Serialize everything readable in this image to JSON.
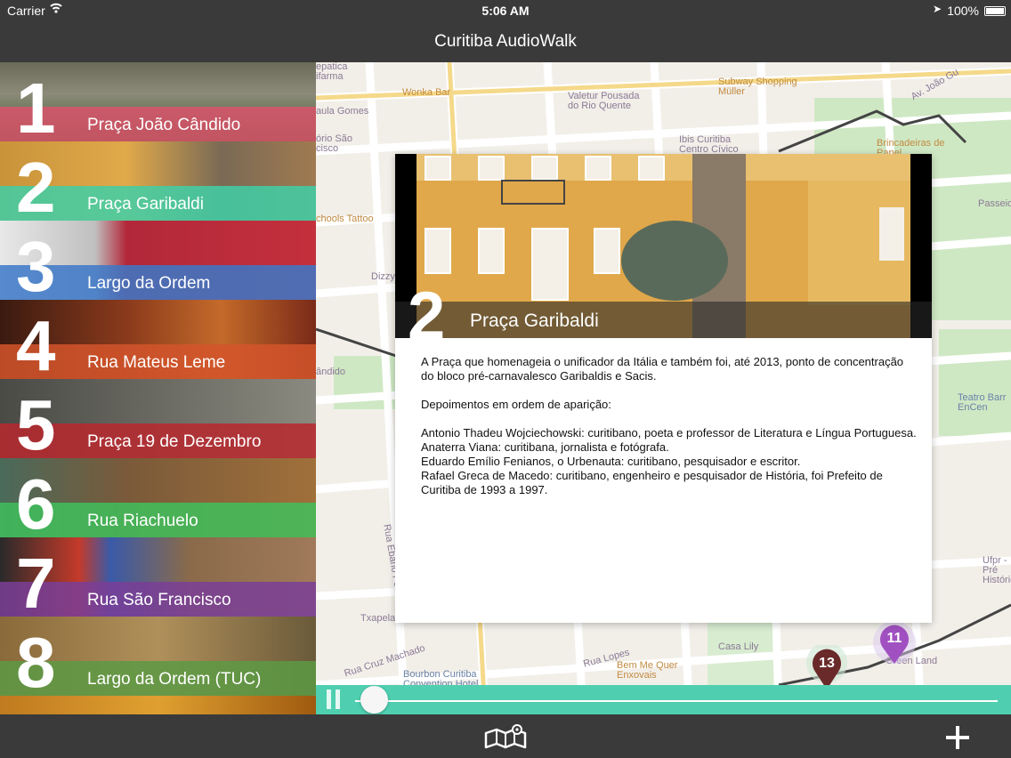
{
  "status": {
    "carrier": "Carrier",
    "time": "5:06 AM",
    "battery": "100%"
  },
  "nav": {
    "title": "Curitiba AudioWalk"
  },
  "stops": [
    {
      "number": "1",
      "label": "Praça João Cândido",
      "color": "#d9536b"
    },
    {
      "number": "2",
      "label": "Praça Garibaldi",
      "color": "#3fcfa7"
    },
    {
      "number": "3",
      "label": "Largo da Ordem",
      "color": "#3c78c8"
    },
    {
      "number": "4",
      "label": "Rua Mateus Leme",
      "color": "#d4552c"
    },
    {
      "number": "5",
      "label": "Praça 19 de Dezembro",
      "color": "#b8282e"
    },
    {
      "number": "6",
      "label": "Rua Riachuelo",
      "color": "#3fbf5c"
    },
    {
      "number": "7",
      "label": "Rua São Francisco",
      "color": "#7a3e98"
    },
    {
      "number": "8",
      "label": "Largo da Ordem (TUC)",
      "color": "#5c9a44"
    }
  ],
  "map": {
    "labels": [
      "Wonka Bar",
      "Valetur Pousada do Rio Quente",
      "Subway Shopping Müller",
      "Ibis Curitiba Centro Cívico",
      "Brincadeiras de Papel",
      "Passeio",
      "Teatro Barr EnCen",
      "Ufpr - Pré Histórico",
      "Casa Lily",
      "Green Land",
      "Bem Me Quer Enxovais",
      "Bourbon Curitiba Convention Hotel",
      "Txapela",
      "Rua Cruz Machado",
      "Rua Ébano Pereira",
      "Av. João Gu",
      "aula Gomes",
      "ório São cisco",
      "chools Tattoo",
      "ândido",
      "epatica ifarma",
      "Rua Lopes",
      "Dizzy"
    ],
    "markers": [
      "11",
      "13"
    ]
  },
  "detail": {
    "number": "2",
    "title": "Praça Garibaldi",
    "intro": "A Praça que homenageia o unificador da Itália e também foi, até 2013, ponto de concentração do bloco pré-carnavalesco Garibaldis e Sacis.",
    "heading": "Depoimentos em ordem de aparição:",
    "lines": [
      "Antonio Thadeu Wojciechowski: curitibano, poeta e professor de Literatura e Língua Portuguesa.",
      "Anaterra Viana: curitibana, jornalista e fotógrafa.",
      "Eduardo Emílio Fenianos, o Urbenauta: curitibano, pesquisador e escritor.",
      "Rafael Greca de Macedo: curitibano, engenheiro e pesquisador de História, foi Prefeito de Curitiba de 1993 a 1997."
    ]
  },
  "player": {
    "progress": 0.01,
    "accent": "#4fcfb0"
  }
}
